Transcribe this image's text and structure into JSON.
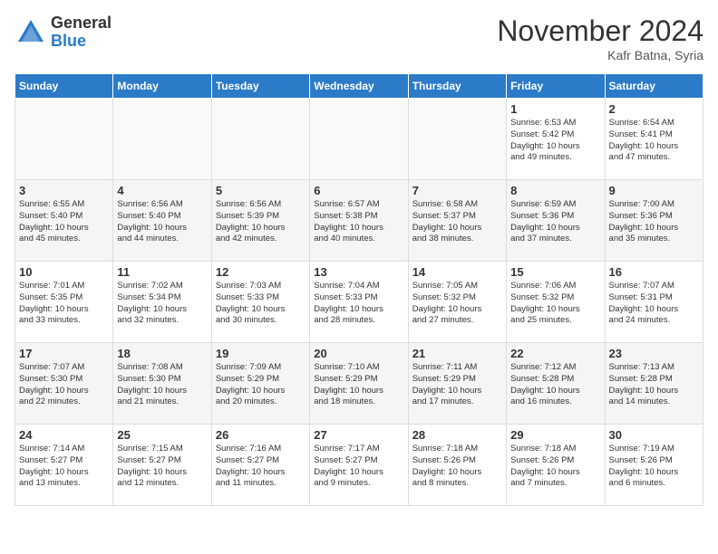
{
  "header": {
    "logo_general": "General",
    "logo_blue": "Blue",
    "month_title": "November 2024",
    "location": "Kafr Batna, Syria"
  },
  "days_of_week": [
    "Sunday",
    "Monday",
    "Tuesday",
    "Wednesday",
    "Thursday",
    "Friday",
    "Saturday"
  ],
  "weeks": [
    [
      {
        "day": "",
        "info": ""
      },
      {
        "day": "",
        "info": ""
      },
      {
        "day": "",
        "info": ""
      },
      {
        "day": "",
        "info": ""
      },
      {
        "day": "",
        "info": ""
      },
      {
        "day": "1",
        "info": "Sunrise: 6:53 AM\nSunset: 5:42 PM\nDaylight: 10 hours\nand 49 minutes."
      },
      {
        "day": "2",
        "info": "Sunrise: 6:54 AM\nSunset: 5:41 PM\nDaylight: 10 hours\nand 47 minutes."
      }
    ],
    [
      {
        "day": "3",
        "info": "Sunrise: 6:55 AM\nSunset: 5:40 PM\nDaylight: 10 hours\nand 45 minutes."
      },
      {
        "day": "4",
        "info": "Sunrise: 6:56 AM\nSunset: 5:40 PM\nDaylight: 10 hours\nand 44 minutes."
      },
      {
        "day": "5",
        "info": "Sunrise: 6:56 AM\nSunset: 5:39 PM\nDaylight: 10 hours\nand 42 minutes."
      },
      {
        "day": "6",
        "info": "Sunrise: 6:57 AM\nSunset: 5:38 PM\nDaylight: 10 hours\nand 40 minutes."
      },
      {
        "day": "7",
        "info": "Sunrise: 6:58 AM\nSunset: 5:37 PM\nDaylight: 10 hours\nand 38 minutes."
      },
      {
        "day": "8",
        "info": "Sunrise: 6:59 AM\nSunset: 5:36 PM\nDaylight: 10 hours\nand 37 minutes."
      },
      {
        "day": "9",
        "info": "Sunrise: 7:00 AM\nSunset: 5:36 PM\nDaylight: 10 hours\nand 35 minutes."
      }
    ],
    [
      {
        "day": "10",
        "info": "Sunrise: 7:01 AM\nSunset: 5:35 PM\nDaylight: 10 hours\nand 33 minutes."
      },
      {
        "day": "11",
        "info": "Sunrise: 7:02 AM\nSunset: 5:34 PM\nDaylight: 10 hours\nand 32 minutes."
      },
      {
        "day": "12",
        "info": "Sunrise: 7:03 AM\nSunset: 5:33 PM\nDaylight: 10 hours\nand 30 minutes."
      },
      {
        "day": "13",
        "info": "Sunrise: 7:04 AM\nSunset: 5:33 PM\nDaylight: 10 hours\nand 28 minutes."
      },
      {
        "day": "14",
        "info": "Sunrise: 7:05 AM\nSunset: 5:32 PM\nDaylight: 10 hours\nand 27 minutes."
      },
      {
        "day": "15",
        "info": "Sunrise: 7:06 AM\nSunset: 5:32 PM\nDaylight: 10 hours\nand 25 minutes."
      },
      {
        "day": "16",
        "info": "Sunrise: 7:07 AM\nSunset: 5:31 PM\nDaylight: 10 hours\nand 24 minutes."
      }
    ],
    [
      {
        "day": "17",
        "info": "Sunrise: 7:07 AM\nSunset: 5:30 PM\nDaylight: 10 hours\nand 22 minutes."
      },
      {
        "day": "18",
        "info": "Sunrise: 7:08 AM\nSunset: 5:30 PM\nDaylight: 10 hours\nand 21 minutes."
      },
      {
        "day": "19",
        "info": "Sunrise: 7:09 AM\nSunset: 5:29 PM\nDaylight: 10 hours\nand 20 minutes."
      },
      {
        "day": "20",
        "info": "Sunrise: 7:10 AM\nSunset: 5:29 PM\nDaylight: 10 hours\nand 18 minutes."
      },
      {
        "day": "21",
        "info": "Sunrise: 7:11 AM\nSunset: 5:29 PM\nDaylight: 10 hours\nand 17 minutes."
      },
      {
        "day": "22",
        "info": "Sunrise: 7:12 AM\nSunset: 5:28 PM\nDaylight: 10 hours\nand 16 minutes."
      },
      {
        "day": "23",
        "info": "Sunrise: 7:13 AM\nSunset: 5:28 PM\nDaylight: 10 hours\nand 14 minutes."
      }
    ],
    [
      {
        "day": "24",
        "info": "Sunrise: 7:14 AM\nSunset: 5:27 PM\nDaylight: 10 hours\nand 13 minutes."
      },
      {
        "day": "25",
        "info": "Sunrise: 7:15 AM\nSunset: 5:27 PM\nDaylight: 10 hours\nand 12 minutes."
      },
      {
        "day": "26",
        "info": "Sunrise: 7:16 AM\nSunset: 5:27 PM\nDaylight: 10 hours\nand 11 minutes."
      },
      {
        "day": "27",
        "info": "Sunrise: 7:17 AM\nSunset: 5:27 PM\nDaylight: 10 hours\nand 9 minutes."
      },
      {
        "day": "28",
        "info": "Sunrise: 7:18 AM\nSunset: 5:26 PM\nDaylight: 10 hours\nand 8 minutes."
      },
      {
        "day": "29",
        "info": "Sunrise: 7:18 AM\nSunset: 5:26 PM\nDaylight: 10 hours\nand 7 minutes."
      },
      {
        "day": "30",
        "info": "Sunrise: 7:19 AM\nSunset: 5:26 PM\nDaylight: 10 hours\nand 6 minutes."
      }
    ]
  ]
}
